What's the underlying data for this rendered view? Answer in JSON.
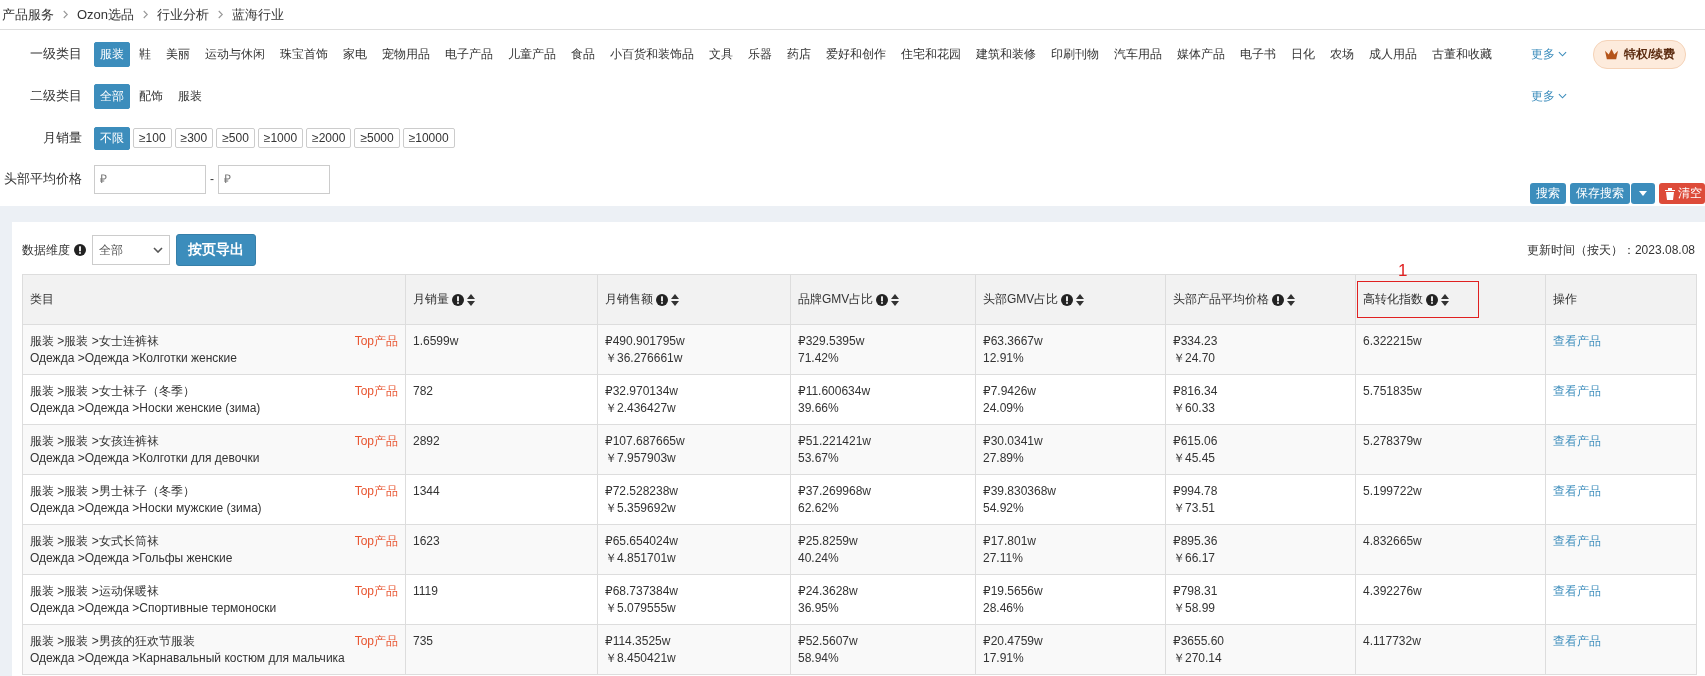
{
  "breadcrumb": [
    "产品服务",
    "Ozon选品",
    "行业分析",
    "蓝海行业"
  ],
  "filters": [
    {
      "kind": "chips",
      "label": "一级类目",
      "more": "更多",
      "options": [
        {
          "label": "服装",
          "selected": true
        },
        {
          "label": "鞋",
          "selected": false
        },
        {
          "label": "美丽",
          "selected": false
        },
        {
          "label": "运动与休闲",
          "selected": false
        },
        {
          "label": "珠宝首饰",
          "selected": false
        },
        {
          "label": "家电",
          "selected": false
        },
        {
          "label": "宠物用品",
          "selected": false
        },
        {
          "label": "电子产品",
          "selected": false
        },
        {
          "label": "儿童产品",
          "selected": false
        },
        {
          "label": "食品",
          "selected": false
        },
        {
          "label": "小百货和装饰品",
          "selected": false
        },
        {
          "label": "文具",
          "selected": false
        },
        {
          "label": "乐器",
          "selected": false
        },
        {
          "label": "药店",
          "selected": false
        },
        {
          "label": "爱好和创作",
          "selected": false
        },
        {
          "label": "住宅和花园",
          "selected": false
        },
        {
          "label": "建筑和装修",
          "selected": false
        },
        {
          "label": "印刷刊物",
          "selected": false
        },
        {
          "label": "汽车用品",
          "selected": false
        },
        {
          "label": "媒体产品",
          "selected": false
        },
        {
          "label": "电子书",
          "selected": false
        },
        {
          "label": "日化",
          "selected": false
        },
        {
          "label": "农场",
          "selected": false
        },
        {
          "label": "成人用品",
          "selected": false
        },
        {
          "label": "古董和收藏",
          "selected": false
        }
      ]
    },
    {
      "kind": "chips",
      "label": "二级类目",
      "more": "更多",
      "options": [
        {
          "label": "全部",
          "selected": true
        },
        {
          "label": "配饰",
          "selected": false
        },
        {
          "label": "服装",
          "selected": false
        }
      ]
    },
    {
      "kind": "boxed",
      "label": "月销量",
      "options": [
        {
          "label": "不限",
          "selected": true
        },
        {
          "label": "≥100",
          "selected": false
        },
        {
          "label": "≥300",
          "selected": false
        },
        {
          "label": "≥500",
          "selected": false
        },
        {
          "label": "≥1000",
          "selected": false
        },
        {
          "label": "≥2000",
          "selected": false
        },
        {
          "label": "≥5000",
          "selected": false
        },
        {
          "label": "≥10000",
          "selected": false
        }
      ]
    },
    {
      "kind": "range",
      "label": "头部平均价格",
      "placeholders": [
        "₽",
        "₽"
      ],
      "separator": "-"
    }
  ],
  "privilege_button": "特权/续费",
  "actions": {
    "search": "搜索",
    "save": "保存搜索",
    "clear": "清空"
  },
  "toolbar": {
    "dimension_label": "数据维度",
    "dimension_value": "全部",
    "export": "按页导出",
    "updated": "更新时间（按天）：2023.08.08"
  },
  "columns": [
    {
      "label": "类目",
      "info": false,
      "sortable": false
    },
    {
      "label": "月销量",
      "info": true,
      "sortable": true
    },
    {
      "label": "月销售额",
      "info": true,
      "sortable": true
    },
    {
      "label": "品牌GMV占比",
      "info": true,
      "sortable": true
    },
    {
      "label": "头部GMV占比",
      "info": true,
      "sortable": true
    },
    {
      "label": "头部产品平均价格",
      "info": true,
      "sortable": true
    },
    {
      "label": "高转化指数",
      "info": true,
      "sortable": true,
      "annotation": "1"
    },
    {
      "label": "操作",
      "info": false,
      "sortable": false
    }
  ],
  "rows": [
    {
      "category": [
        "服装 >服装 >女士连裤袜",
        "Одежда >Одежда >Колготки женские"
      ],
      "tag": "Top产品",
      "sales": "1.6599w",
      "revenue": [
        "₽490.901795w",
        "￥36.276661w"
      ],
      "brand_gmv": [
        "₽329.5395w",
        "71.42%"
      ],
      "head_gmv": [
        "₽63.3667w",
        "12.91%"
      ],
      "head_price": [
        "₽334.23",
        "￥24.70"
      ],
      "conversion": "6.322215w",
      "action": "查看产品"
    },
    {
      "category": [
        "服装 >服装 >女士袜子（冬季）",
        "Одежда >Одежда >Носки женские (зима)"
      ],
      "tag": "Top产品",
      "sales": "782",
      "revenue": [
        "₽32.970134w",
        "￥2.436427w"
      ],
      "brand_gmv": [
        "₽11.600634w",
        "39.66%"
      ],
      "head_gmv": [
        "₽7.9426w",
        "24.09%"
      ],
      "head_price": [
        "₽816.34",
        "￥60.33"
      ],
      "conversion": "5.751835w",
      "action": "查看产品"
    },
    {
      "category": [
        "服装 >服装 >女孩连裤袜",
        "Одежда >Одежда >Колготки для девочки"
      ],
      "tag": "Top产品",
      "sales": "2892",
      "revenue": [
        "₽107.687665w",
        "￥7.957903w"
      ],
      "brand_gmv": [
        "₽51.221421w",
        "53.67%"
      ],
      "head_gmv": [
        "₽30.0341w",
        "27.89%"
      ],
      "head_price": [
        "₽615.06",
        "￥45.45"
      ],
      "conversion": "5.278379w",
      "action": "查看产品"
    },
    {
      "category": [
        "服装 >服装 >男士袜子（冬季）",
        "Одежда >Одежда >Носки мужские (зима)"
      ],
      "tag": "Top产品",
      "sales": "1344",
      "revenue": [
        "₽72.528238w",
        "￥5.359692w"
      ],
      "brand_gmv": [
        "₽37.269968w",
        "62.62%"
      ],
      "head_gmv": [
        "₽39.830368w",
        "54.92%"
      ],
      "head_price": [
        "₽994.78",
        "￥73.51"
      ],
      "conversion": "5.199722w",
      "action": "查看产品"
    },
    {
      "category": [
        "服装 >服装 >女式长筒袜",
        "Одежда >Одежда >Гольфы женские"
      ],
      "tag": "Top产品",
      "sales": "1623",
      "revenue": [
        "₽65.654024w",
        "￥4.851701w"
      ],
      "brand_gmv": [
        "₽25.8259w",
        "40.24%"
      ],
      "head_gmv": [
        "₽17.801w",
        "27.11%"
      ],
      "head_price": [
        "₽895.36",
        "￥66.17"
      ],
      "conversion": "4.832665w",
      "action": "查看产品"
    },
    {
      "category": [
        "服装 >服装 >运动保暖袜",
        "Одежда >Одежда >Спортивные термоноски"
      ],
      "tag": "Top产品",
      "sales": "1119",
      "revenue": [
        "₽68.737384w",
        "￥5.079555w"
      ],
      "brand_gmv": [
        "₽24.3628w",
        "36.95%"
      ],
      "head_gmv": [
        "₽19.5656w",
        "28.46%"
      ],
      "head_price": [
        "₽798.31",
        "￥58.99"
      ],
      "conversion": "4.392276w",
      "action": "查看产品"
    },
    {
      "category": [
        "服装 >服装 >男孩的狂欢节服装",
        "Одежда >Одежда >Карнавальный костюм для мальчика"
      ],
      "tag": "Top产品",
      "sales": "735",
      "revenue": [
        "₽114.3525w",
        "￥8.450421w"
      ],
      "brand_gmv": [
        "₽52.5607w",
        "58.94%"
      ],
      "head_gmv": [
        "₽20.4759w",
        "17.91%"
      ],
      "head_price": [
        "₽3655.60",
        "￥270.14"
      ],
      "conversion": "4.117732w",
      "action": "查看产品"
    }
  ]
}
